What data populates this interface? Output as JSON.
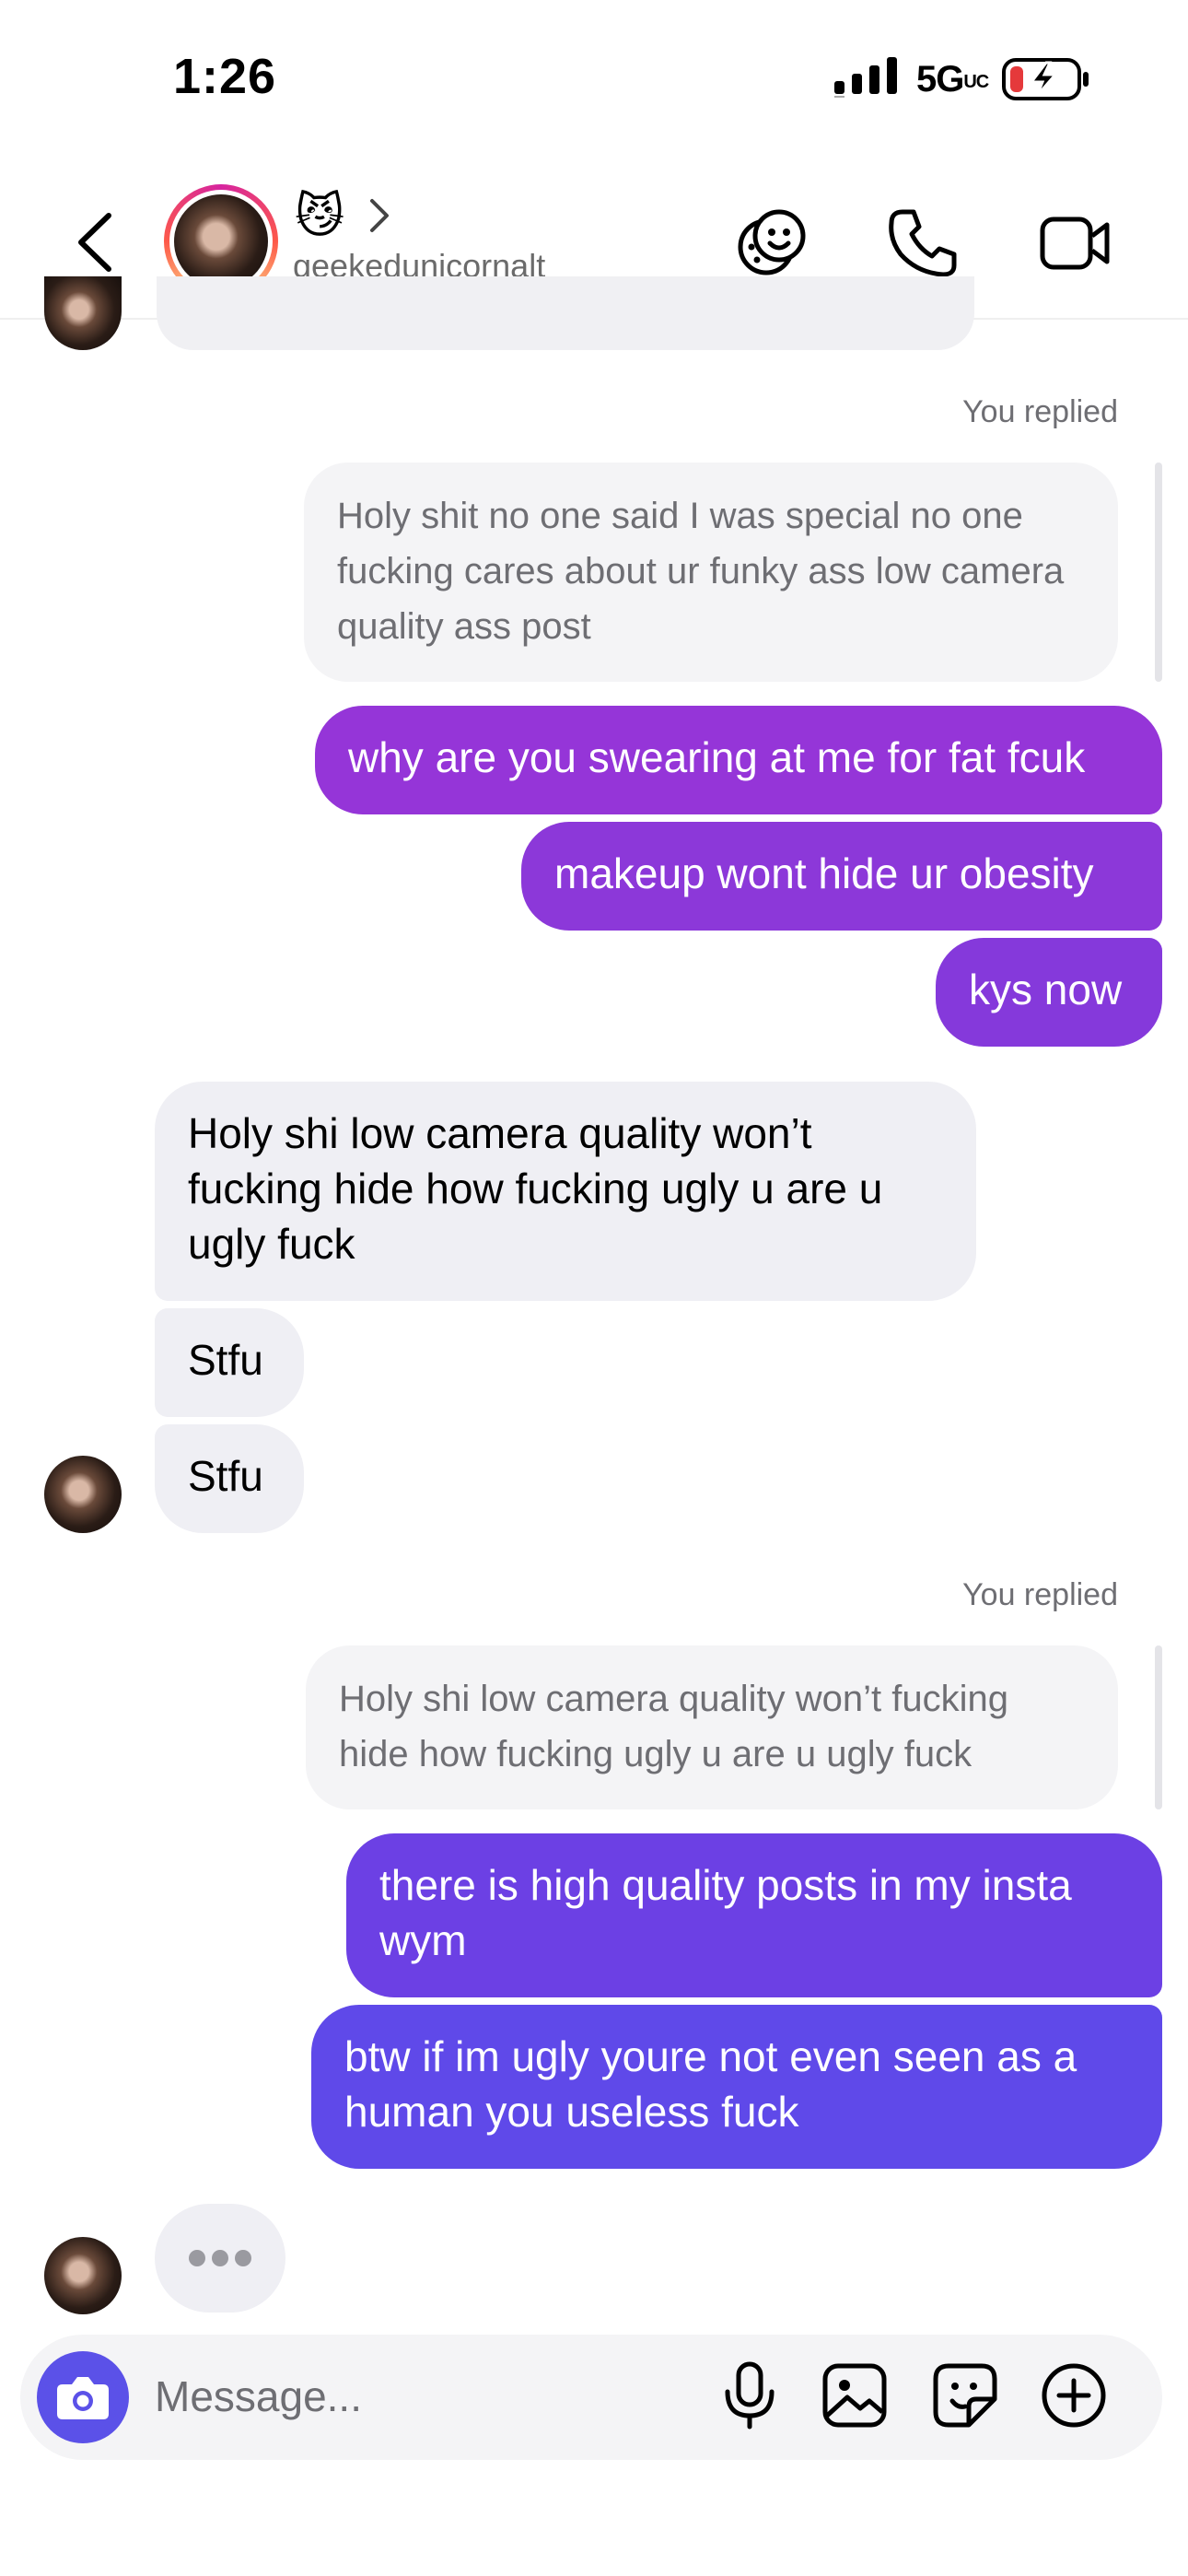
{
  "status_bar": {
    "time": "1:26",
    "network": "5G",
    "network_sub": "UC"
  },
  "header": {
    "emoji": "😼",
    "username": "geekedunicornalt"
  },
  "messages": {
    "reply1_label": "You replied",
    "quote1": "Holy shit no one said I was special no one fucking cares about ur funky ass low camera quality ass post",
    "out1": "why are you swearing at me for fat fcuk",
    "out2": "makeup wont hide ur obesity",
    "out3": "kys now",
    "in1": "Holy shi low camera quality won’t fucking hide how fucking ugly u are u ugly fuck",
    "in2": "Stfu",
    "in3": "Stfu",
    "reply2_label": "You replied",
    "quote2": "Holy shi low camera quality won’t fucking hide how fucking ugly u are u ugly fuck",
    "out4": "there is high quality posts in my insta wym",
    "out5": "btw if im ugly youre not even seen as a human you useless fuck"
  },
  "composer": {
    "placeholder": "Message..."
  },
  "icons": {
    "back": "chevron-left-icon",
    "sticker": "sticker-face-icon",
    "call": "phone-icon",
    "video": "video-camera-icon",
    "camera": "camera-icon",
    "mic": "microphone-icon",
    "gallery": "image-icon",
    "sticker2": "sticker-icon",
    "add": "plus-circle-icon"
  },
  "colors": {
    "purple_top": "#9535d8",
    "purple_mid": "#7a3fe0",
    "indigo_bottom": "#5f49e9",
    "camera_blue": "#5b51e8"
  }
}
